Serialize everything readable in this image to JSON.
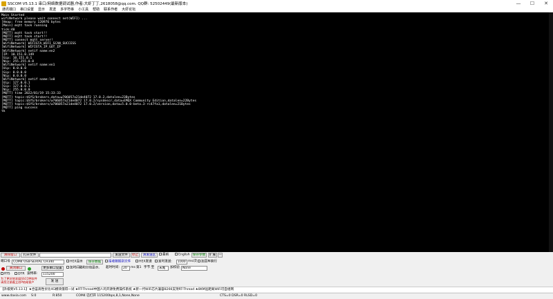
{
  "window": {
    "title": "SSCOM V5.13.1 串口/网络数据调试器,作者:大虾丁丁,2618058@qq.com. QQ群: 52502449(最新版本)",
    "minimize": "—",
    "maximize": "☐",
    "close": "✕"
  },
  "menu": [
    "通讯端口",
    "串口设置",
    "显示",
    "发送",
    "多字符串",
    "小工具",
    "帮助",
    "联系作者",
    "大虾论坛"
  ],
  "terminal": {
    "lines": [
      "Main Started",
      "wifiNetwork please wait connect net(WIFI) ...",
      "[Heap: free memory 120976 bytes",
      "[Main] mqtt task running",
      "tick:40",
      "[MQTT] mqtt task start!!",
      "[MQTT] mqtt task start!!",
      "[MQTT] connect mqtt server!",
      "[WifiNetwork] WIFISTA_WIFI_SCAN_SUCCESS",
      "[WifiNetwork] WIFISTA_IP_GOT_IP",
      "[WifiNetwork] netif name:en2",
      "[IP: 10.151.0.149",
      "[Gip: 10.151.0.1",
      "[Nip: 255.255.0.0",
      "[WifiNetwork] netif name:en1",
      "[Uip: 0.0.0.0",
      "[Gip: 0.0.0.0",
      "[Nip: 0.0.0.0",
      "[WifiNetwork] netif name:lo0",
      "[Uip: 127.0.0.1",
      "[Gip: 127.0.0.1",
      "[Nip: 255.0.0.0",
      "[MQTT] time 2022/01/19 15:33:33",
      "[MQTT] topic:$SYS/brokers,data=w706057a21de4072 17.0.2,datalen=23Bytes",
      "[MQTT] topic:$SYS/brokers/w706057a21de4072 17.0.2/sysdescr,data=EMQX Community Edition,datalen=22Bytes",
      "[MQTT] topic:$SYS/brokers/w706057a21de4072 17.0.2/version,data=5.0.0-beta.3-rc47fa1,datalen=21Bytes",
      "[MQTT] ping success",
      "tk"
    ]
  },
  "controls": {
    "clear_window": "清除窗口",
    "open_file": "打开文件",
    "send_file": "发送文件",
    "stop": "停止",
    "clear_send": "清发送区",
    "topmost": "最前",
    "english": "English",
    "save_params": "保存参数",
    "expand": "扩展",
    "collapse": "—",
    "port_label": "端口号",
    "port_value": "COM4 USB-SERIAL CH340",
    "hex_display": "HEX显示",
    "save_data": "保存数据",
    "recv_to_file": "接收数据到文件",
    "hex_send": "HEX发送",
    "timed_send": "定时发送:",
    "interval_value": "1000",
    "interval_unit": "ms/次",
    "add_crlf": "加回车换行",
    "more_ports": "更多串口设置",
    "timestamp": "加时间戳和分包显示,",
    "timeout_label": "超时时间:",
    "timeout_value": "20",
    "timeout_unit": "ms",
    "byte_no": "第1",
    "byte_label": "字节 至",
    "tail": "末尾",
    "checksum_label": "加校验",
    "checksum_value": "None",
    "close_port": "关闭串口",
    "rts": "RTS",
    "dtr": "DTR",
    "baud_label": "波特率:",
    "baud_value": "115200",
    "send": "发 送",
    "promo_text": "为了更好地发展SSCOM软件\n请您注册嘉立创P结尾客户"
  },
  "ticker": "【升级到V5.13.1】★合宙高性价比4G模块值得一试 ★RT-Thread中国人的开源免费操作系统 ★新一代WiFi芯片兼容8266支持RT-Thread ★8KM远距离WiFi可自组网",
  "status": {
    "site": "www.daxia.com",
    "s": "S:0",
    "r": "R:850",
    "port_info": "COM4 已打开  115200bps,8,1,None,None",
    "lines": "CTS=0 DSR=0 RLSD=0"
  }
}
